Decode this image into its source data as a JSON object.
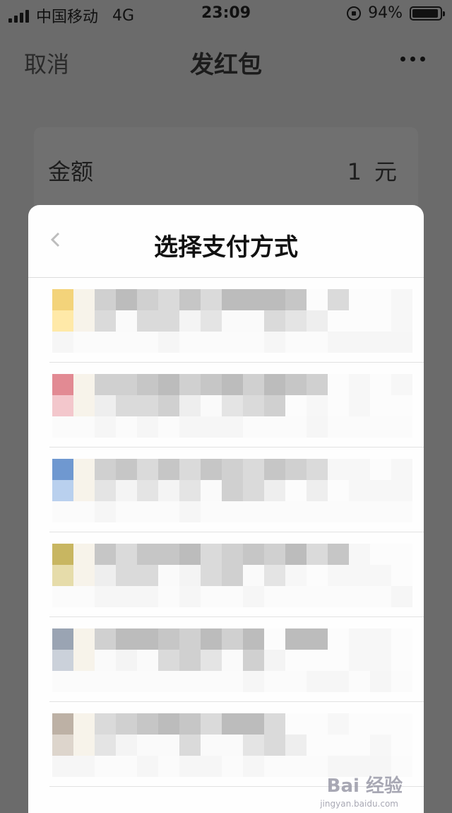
{
  "status_bar": {
    "carrier": "中国移动",
    "network": "4G",
    "time": "23:09",
    "battery": "94%",
    "battery_level": 0.94
  },
  "nav": {
    "cancel": "取消",
    "title": "发红包"
  },
  "amount_card": {
    "label": "金额",
    "value": "1",
    "unit": "元"
  },
  "sheet": {
    "title": "选择支付方式",
    "options": [
      {
        "color": "#f3d37a",
        "tint": "#ffe9a8"
      },
      {
        "color": "#e28a93",
        "tint": "#f3c7cc"
      },
      {
        "color": "#6f98d0",
        "tint": "#b9d0ee"
      },
      {
        "color": "#c8b661",
        "tint": "#e6dcaa"
      },
      {
        "color": "#9aa4b3",
        "tint": "#cbd1da"
      },
      {
        "color": "#bdb1a5",
        "tint": "#ddd5cc"
      }
    ]
  },
  "watermark": {
    "brand": "Bai 经验",
    "url": "jingyan.baidu.com"
  }
}
